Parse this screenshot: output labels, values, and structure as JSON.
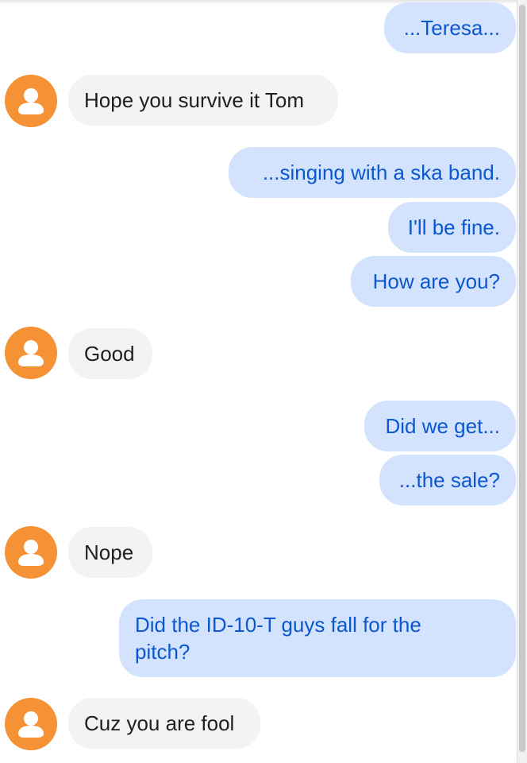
{
  "messages": [
    {
      "side": "out",
      "text": "...Teresa..."
    },
    {
      "side": "in",
      "text": "Hope you survive it Tom"
    },
    {
      "side": "out",
      "text": "...singing with a ska band."
    },
    {
      "side": "out",
      "text": "I'll be fine."
    },
    {
      "side": "out",
      "text": "How are you?"
    },
    {
      "side": "in",
      "text": "Good"
    },
    {
      "side": "out",
      "text": "Did we get..."
    },
    {
      "side": "out",
      "text": "...the sale?"
    },
    {
      "side": "in",
      "text": "Nope"
    },
    {
      "side": "out",
      "text": "Did the ID-10-T guys fall for the pitch?"
    },
    {
      "side": "in",
      "text": "Cuz you are fool"
    }
  ],
  "colors": {
    "outgoing_bubble": "#d3e3fd",
    "outgoing_text": "#0b57d0",
    "incoming_bubble": "#f1f3f4",
    "incoming_text": "#1f1f1f",
    "avatar": "#f59236"
  },
  "icons": {
    "avatar": "person-icon"
  }
}
